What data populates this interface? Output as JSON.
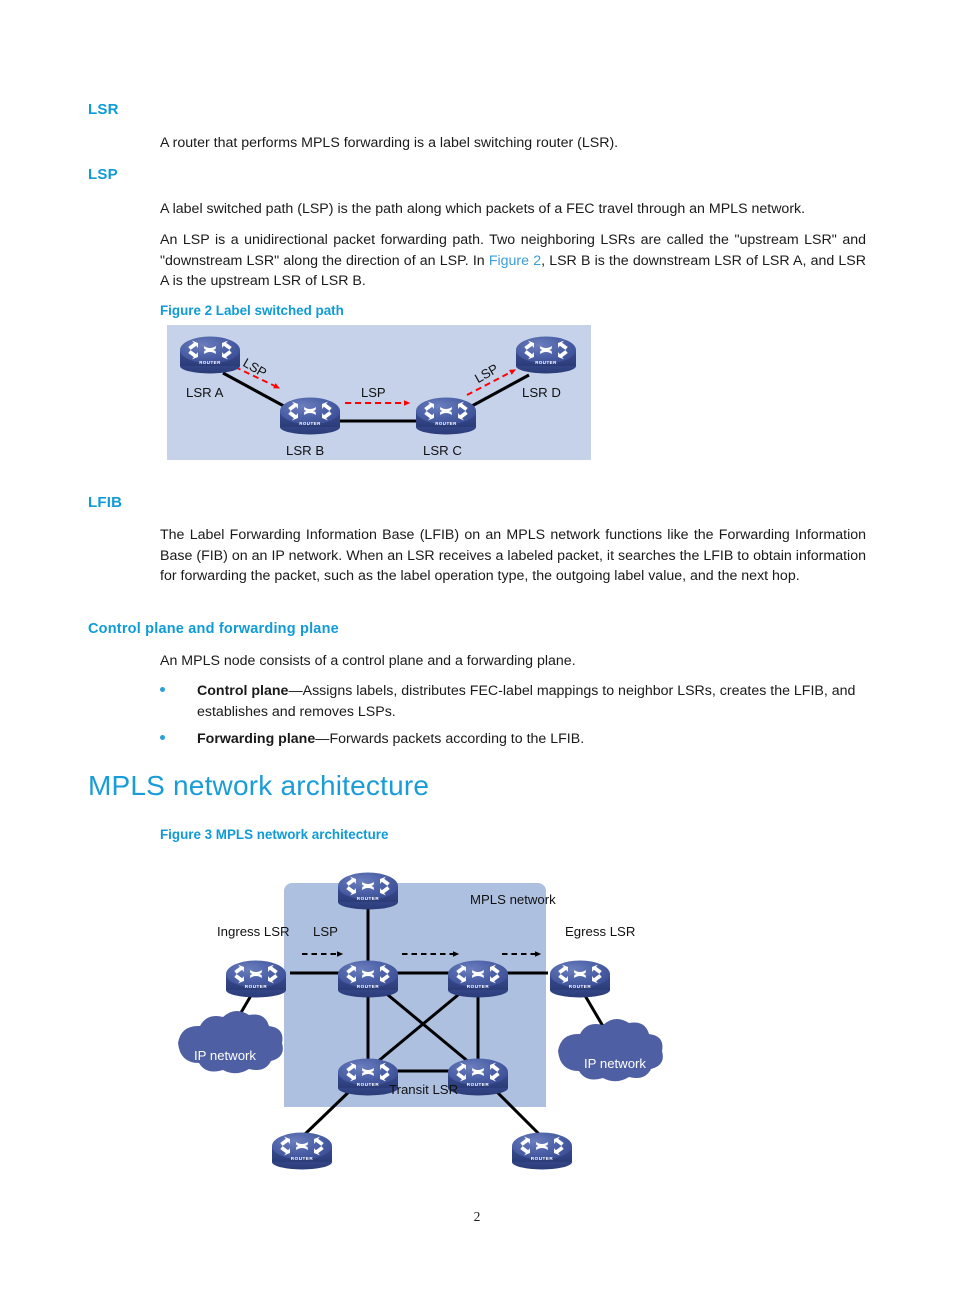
{
  "page": {
    "number": "2",
    "accent_heading": "#0f9bd7",
    "accent_title": "#1a9cd8",
    "link_color": "#3a9ed9"
  },
  "sections": [
    {
      "heading": "LSR",
      "paragraphs": [
        "A router that performs MPLS forwarding is a label switching router (LSR)."
      ]
    },
    {
      "heading": "LSP",
      "paragraphs": [
        "A label switched path (LSP) is the path along which packets of a FEC travel through an MPLS network.",
        "An LSP is a unidirectional packet forwarding path. Two neighboring LSRs are called the \"upstream LSR\" and \"downstream LSR\" along the direction of an LSP. In ",
        ", LSR B is the downstream LSR of LSR A, and LSR A is the upstream LSR of LSR B."
      ],
      "xref": "Figure 2"
    },
    {
      "heading": "LFIB",
      "paragraphs": [
        "The Label Forwarding Information Base (LFIB) on an MPLS network functions like the Forwarding Information Base (FIB) on an IP network. When an LSR receives a labeled packet, it searches the LFIB to obtain information for forwarding the packet, such as the label operation type, the outgoing label value, and the next hop."
      ]
    },
    {
      "heading": "Control plane and forwarding plane",
      "paragraphs": [
        "An MPLS node consists of a control plane and a forwarding plane."
      ],
      "bullets": [
        {
          "bold": "Control plane",
          "rest": "—Assigns labels, distributes FEC-label mappings to neighbor LSRs, creates the LFIB, and establishes and removes LSPs."
        },
        {
          "bold": "Forwarding plane",
          "rest": "—Forwards packets according to the LFIB."
        }
      ]
    }
  ],
  "title": "MPLS network architecture",
  "figure2": {
    "caption": "Figure 2 Label switched path",
    "background_color": "#c6d2ea",
    "nodes": [
      {
        "id": "a",
        "label": "LSR A"
      },
      {
        "id": "b",
        "label": "LSR B"
      },
      {
        "id": "c",
        "label": "LSR C"
      },
      {
        "id": "d",
        "label": "LSR D"
      }
    ],
    "lsp_labels": [
      "LSP",
      "LSP",
      "LSP"
    ],
    "router_icon_text": "ROUTER"
  },
  "figure3": {
    "caption": "Figure 3 MPLS network architecture",
    "background_color": "#aec0e0",
    "cloud_color": "#4f5fa4",
    "area_label": "MPLS network",
    "labels": {
      "ingress": "Ingress LSR",
      "egress": "Egress LSR",
      "transit": "Transit LSR",
      "lsp": "LSP",
      "cloud_left": "IP network",
      "cloud_right": "IP network"
    },
    "router_icon_text": "ROUTER"
  }
}
